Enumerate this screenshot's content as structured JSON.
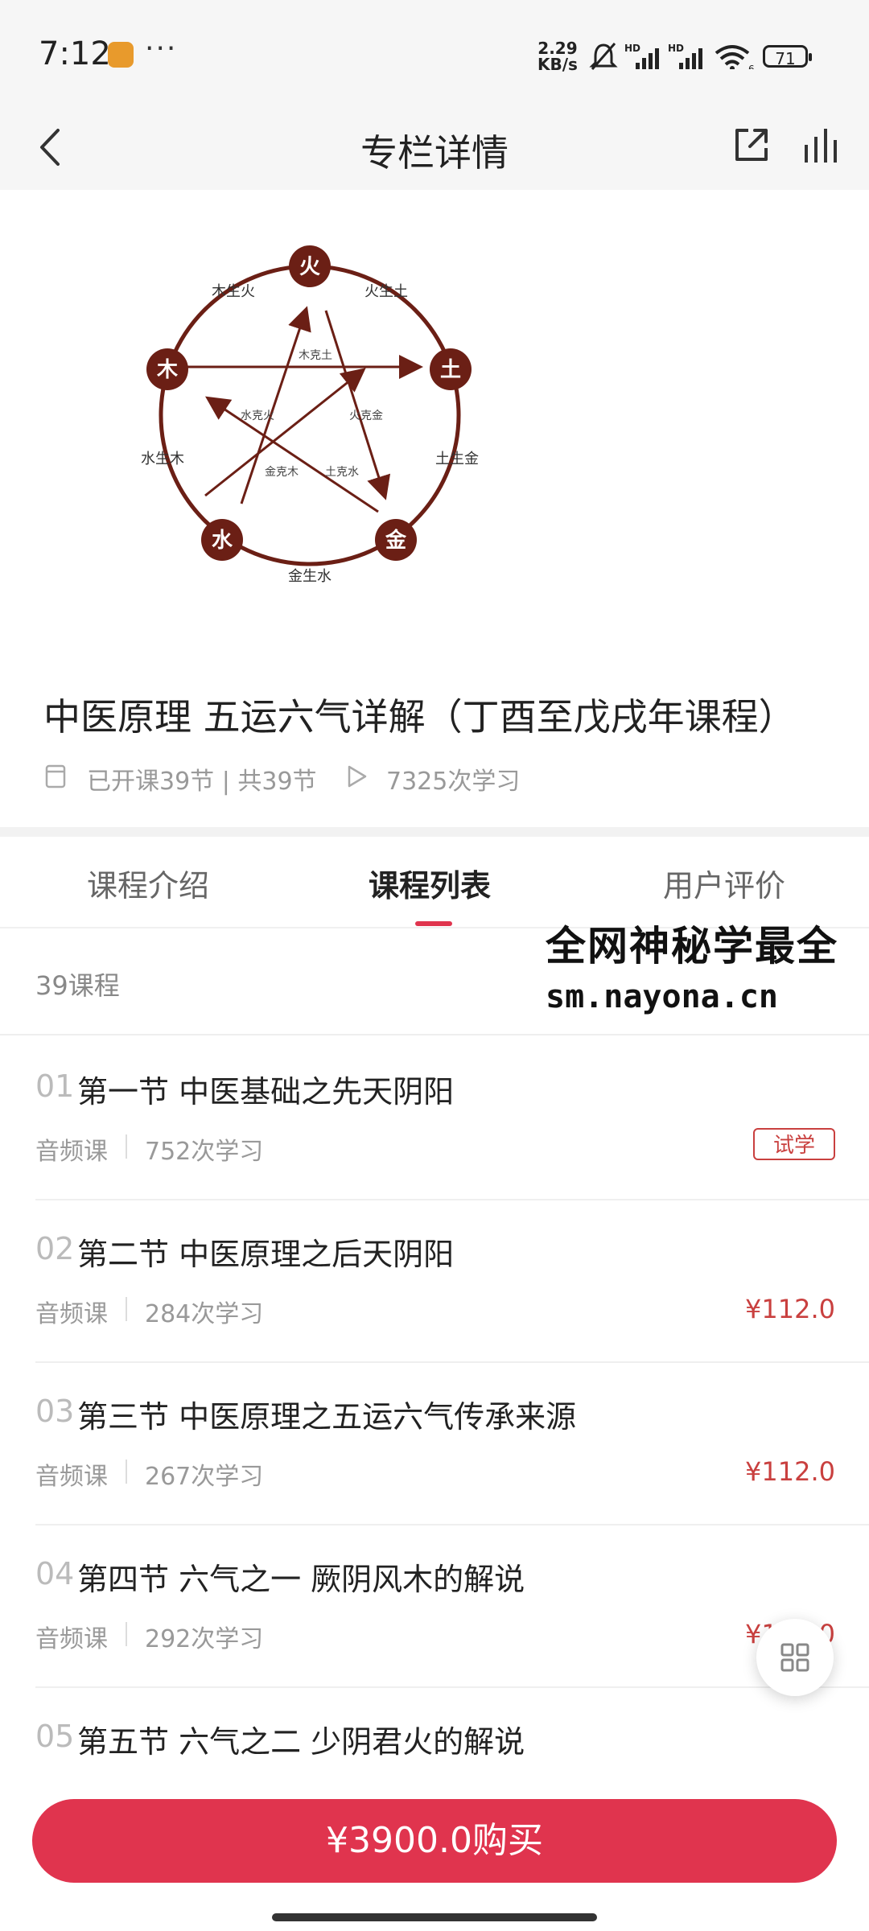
{
  "status_bar": {
    "time": "7:12",
    "net_speed_value": "2.29",
    "net_speed_unit": "KB/s",
    "hd1": "HD",
    "hd2": "HD",
    "wifi_badge": "6",
    "battery": "71"
  },
  "nav": {
    "title": "专栏详情"
  },
  "diagram": {
    "center_labels": [
      "火",
      "土",
      "金",
      "水",
      "木"
    ],
    "sheng_labels": [
      "火生土",
      "土生金",
      "金生水",
      "水生木",
      "木生火"
    ],
    "ke_labels": [
      "木克土",
      "火克金",
      "土克水",
      "金克木",
      "水克火"
    ],
    "colors": {
      "circle": "#6b1f15",
      "text": "#ffffff"
    }
  },
  "course": {
    "title": "中医原理 五运六气详解（丁酉至戊戌年课程）",
    "lessons_meta": "已开课39节 | 共39节",
    "plays_meta": "7325次学习"
  },
  "tabs": [
    {
      "label": "课程介绍"
    },
    {
      "label": "课程列表"
    },
    {
      "label": "用户评价"
    }
  ],
  "watermark": {
    "line1": "全网神秘学最全",
    "line2": "sm.nayona.cn"
  },
  "list": {
    "count": "39课程",
    "items": [
      {
        "num": "01",
        "name": "第一节 中医基础之先天阴阳",
        "type": "音频课",
        "plays": "752次学习",
        "badge": "试学"
      },
      {
        "num": "02",
        "name": "第二节 中医原理之后天阴阳",
        "type": "音频课",
        "plays": "284次学习",
        "price": "¥112.0"
      },
      {
        "num": "03",
        "name": "第三节 中医原理之五运六气传承来源",
        "type": "音频课",
        "plays": "267次学习",
        "price": "¥112.0"
      },
      {
        "num": "04",
        "name": "第四节  六气之一 厥阴风木的解说",
        "type": "音频课",
        "plays": "292次学习",
        "price": "¥112.0"
      },
      {
        "num": "05",
        "name": "第五节 六气之二 少阴君火的解说",
        "type": "音频课",
        "plays": "",
        "price": ""
      }
    ]
  },
  "buy": {
    "label": "¥3900.0购买"
  },
  "colors": {
    "accent": "#e0344e",
    "price": "#c9403f"
  }
}
